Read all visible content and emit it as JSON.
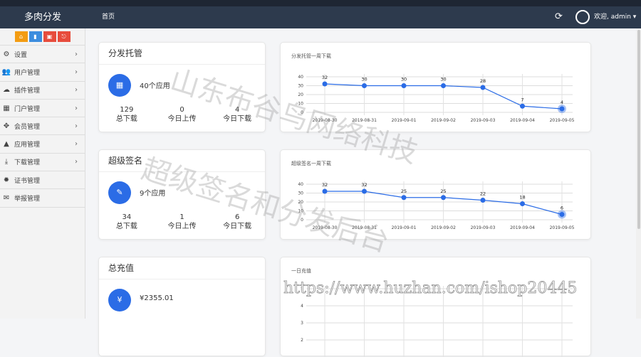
{
  "header": {
    "brand": "多肉分发",
    "nav_home": "首页",
    "user": "欢迎, admin ▾",
    "refresh_icon": "refresh-icon",
    "user_icon": "share-icon"
  },
  "quick_buttons": [
    {
      "icon": "home-icon",
      "glyph": "⌂",
      "color": "#f39c12"
    },
    {
      "icon": "file-icon",
      "glyph": "▮",
      "color": "#3c8dde"
    },
    {
      "icon": "clipboard-icon",
      "glyph": "▣",
      "color": "#e74c3c"
    },
    {
      "icon": "exit-icon",
      "glyph": "⎋",
      "color": "#e74c3c"
    }
  ],
  "sidebar": {
    "items": [
      {
        "label": "设置",
        "glyph": "⚙",
        "icon": "gears-icon",
        "arrow": "›"
      },
      {
        "label": "用户管理",
        "glyph": "👥",
        "icon": "users-icon",
        "arrow": "›"
      },
      {
        "label": "插件管理",
        "glyph": "☁",
        "icon": "cloud-icon",
        "arrow": "›"
      },
      {
        "label": "门户管理",
        "glyph": "▦",
        "icon": "grid-icon",
        "arrow": "›"
      },
      {
        "label": "会员管理",
        "glyph": "✥",
        "icon": "move-icon",
        "arrow": "›"
      },
      {
        "label": "应用管理",
        "glyph": "▲",
        "icon": "android-icon",
        "arrow": "›"
      },
      {
        "label": "下载管理",
        "glyph": "⤓",
        "icon": "download-icon",
        "arrow": "›"
      },
      {
        "label": "证书管理",
        "glyph": "✹",
        "icon": "certificate-icon",
        "arrow": ""
      },
      {
        "label": "举报管理",
        "glyph": "✉",
        "icon": "envelope-open-icon",
        "arrow": ""
      }
    ]
  },
  "summaries": [
    {
      "title": "分发托管",
      "apps": "40个应用",
      "glyph": "▦",
      "stats": [
        {
          "value": "129",
          "label": "总下载"
        },
        {
          "value": "0",
          "label": "今日上传"
        },
        {
          "value": "4",
          "label": "今日下载"
        }
      ]
    },
    {
      "title": "超级签名",
      "apps": "9个应用",
      "glyph": "✎",
      "stats": [
        {
          "value": "34",
          "label": "总下载"
        },
        {
          "value": "1",
          "label": "今日上传"
        },
        {
          "value": "6",
          "label": "今日下载"
        }
      ]
    },
    {
      "title": "总充值",
      "apps": "¥2355.01",
      "glyph": "¥",
      "stats": []
    }
  ],
  "chart_data": [
    {
      "type": "line",
      "title": "分发托管一周下载",
      "categories": [
        "2019-08-30",
        "2019-08-31",
        "2019-09-01",
        "2019-09-02",
        "2019-09-03",
        "2019-09-04",
        "2019-09-05"
      ],
      "values": [
        32,
        30,
        30,
        30,
        28,
        7,
        4
      ],
      "ylim": [
        0,
        40
      ],
      "yticks": [
        0,
        10,
        20,
        30,
        40
      ],
      "color": "#2b6ce6",
      "grid": true
    },
    {
      "type": "line",
      "title": "超级签名一周下载",
      "categories": [
        "2019-08-30",
        "2019-08-31",
        "2019-09-01",
        "2019-09-02",
        "2019-09-03",
        "2019-09-04",
        "2019-09-05"
      ],
      "values": [
        32,
        32,
        25,
        25,
        22,
        18,
        6
      ],
      "ylim": [
        0,
        40
      ],
      "yticks": [
        0,
        10,
        20,
        30,
        40
      ],
      "color": "#2b6ce6",
      "grid": true
    },
    {
      "type": "line",
      "title": "一日充值",
      "categories": [],
      "values": [],
      "ylim": [
        0,
        5
      ],
      "yticks": [
        2,
        3,
        4,
        5
      ],
      "color": "#2b6ce6",
      "grid": true
    }
  ],
  "watermarks": {
    "company": "山东布谷鸟网络科技",
    "subtitle": "超级签名和分发后台",
    "url": "https://www.huzhan.com/ishop20445"
  }
}
